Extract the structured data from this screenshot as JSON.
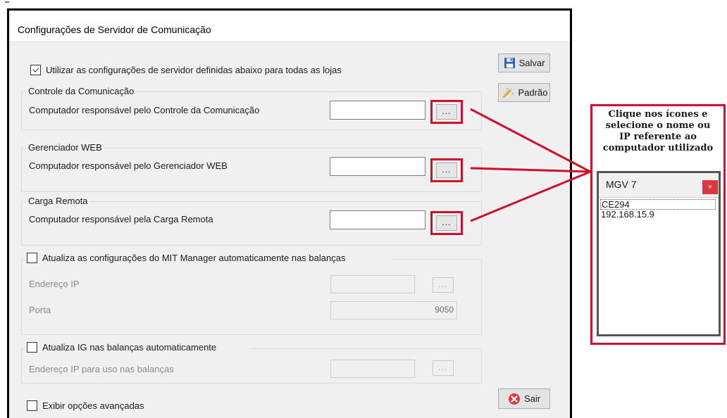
{
  "dialog": {
    "title": "Configurações de Servidor de Comunicação",
    "use_config_checkbox": {
      "label": "Utilizar as configurações de servidor definidas abaixo para todas as lojas",
      "checked": true
    },
    "buttons": {
      "save": "Salvar",
      "default": "Padrão",
      "exit": "Sair"
    },
    "groups": {
      "controle": {
        "title": "Controle da Comunicação",
        "label": "Computador responsável pelo Controle da Comunicação",
        "value": "",
        "browse": "..."
      },
      "gerenciador": {
        "title": "Gerenciador WEB",
        "label": "Computador responsável pelo Gerenciador WEB",
        "value": "",
        "browse": "..."
      },
      "carga": {
        "title": "Carga Remota",
        "label": "Computador responsável pela Carga Remota",
        "value": "",
        "browse": "..."
      },
      "mit": {
        "checkbox_label": "Atualiza as configurações do MIT Manager automaticamente nas balanças",
        "checked": false,
        "ip_label": "Endereço IP",
        "ip_value": "",
        "browse": "...",
        "port_label": "Porta",
        "port_value": "9050"
      },
      "ig": {
        "checkbox_label": "Atualiza IG nas balanças automaticamente",
        "checked": false,
        "ip_label": "Endereço IP para uso nas balanças",
        "ip_value": "",
        "browse": "..."
      }
    },
    "advanced_checkbox": {
      "label": "Exibir opções avançadas",
      "checked": false
    }
  },
  "annotation": {
    "lines": [
      "Clique nos ícones e",
      "selecione o nome ou",
      "IP referente ao",
      "computador utilizado"
    ],
    "popup": {
      "title": "MGV 7",
      "close": "×",
      "items": [
        "CE294",
        "192.168.15.9"
      ],
      "selected_index": 0
    }
  },
  "colors": {
    "highlight": "#d0102a",
    "dialog_bg": "#f0f0f0",
    "close_button": "#d9363e"
  },
  "icons": {
    "save": "floppy-disk-icon",
    "default": "wand-icon",
    "exit": "red-x-circle-icon"
  }
}
